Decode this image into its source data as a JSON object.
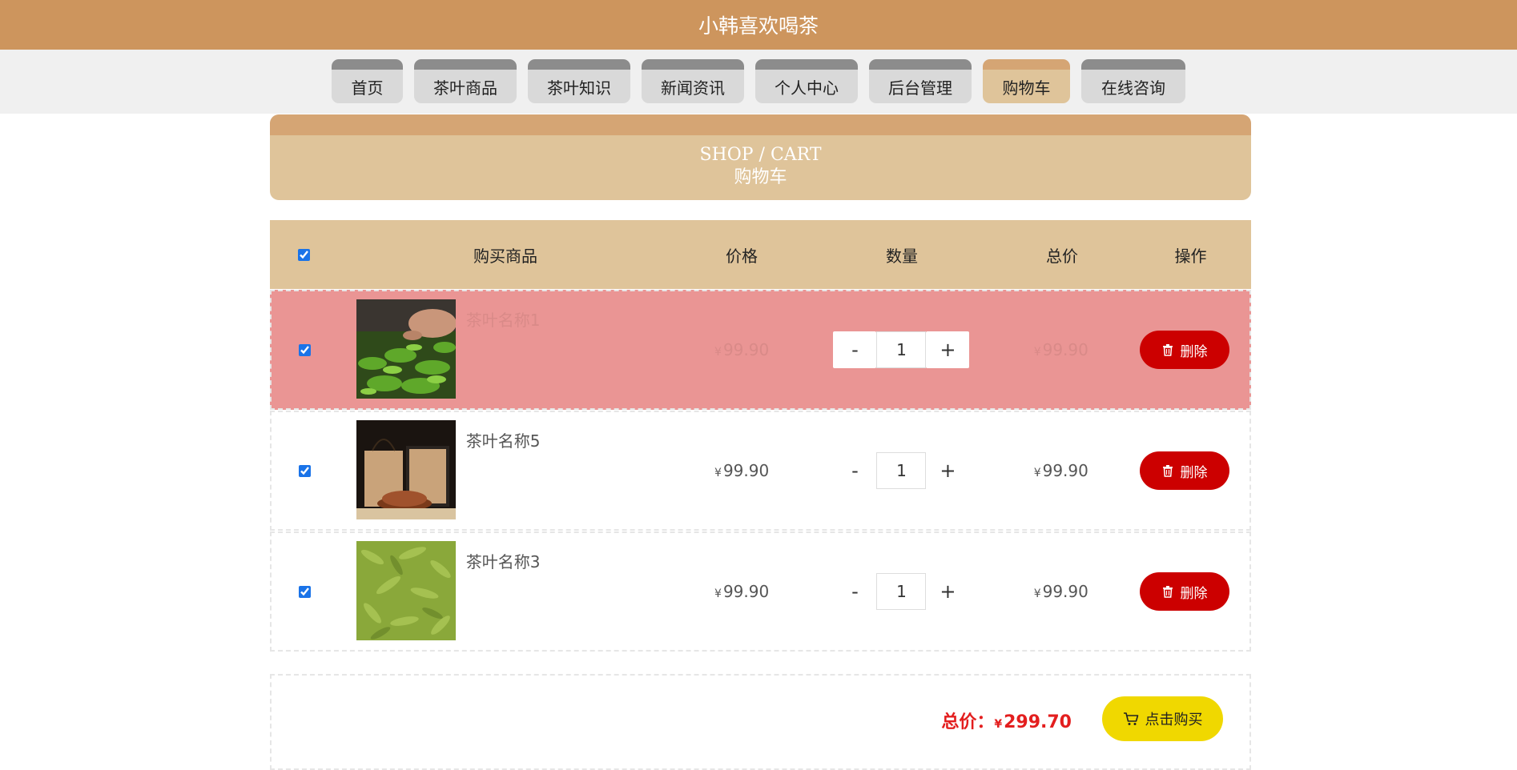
{
  "header": {
    "title": "小韩喜欢喝茶"
  },
  "nav": {
    "items": [
      {
        "label": "首页",
        "width": 89
      },
      {
        "label": "茶叶商品",
        "width": 128
      },
      {
        "label": "茶叶知识",
        "width": 128
      },
      {
        "label": "新闻资讯",
        "width": 128
      },
      {
        "label": "个人中心",
        "width": 128
      },
      {
        "label": "后台管理",
        "width": 128
      },
      {
        "label": "购物车",
        "width": 109,
        "active": true
      },
      {
        "label": "在线咨询",
        "width": 130
      }
    ]
  },
  "banner": {
    "en": "SHOP / CART",
    "zh": "购物车"
  },
  "table": {
    "headers": {
      "product": "购买商品",
      "price": "价格",
      "qty": "数量",
      "total": "总价",
      "op": "操作"
    },
    "rows": [
      {
        "name": "茶叶名称1",
        "price": "99.90",
        "qty": "1",
        "total": "99.90",
        "highlight": true,
        "image": "tea-picking"
      },
      {
        "name": "茶叶名称5",
        "price": "99.90",
        "qty": "1",
        "total": "99.90",
        "highlight": false,
        "image": "tea-giftbox"
      },
      {
        "name": "茶叶名称3",
        "price": "99.90",
        "qty": "1",
        "total": "99.90",
        "highlight": false,
        "image": "tea-leaves"
      }
    ],
    "currency": "¥",
    "minus": "-",
    "plus": "+",
    "delete_label": "删除"
  },
  "footer": {
    "total_label": "总价：",
    "currency": "¥",
    "total_value": "299.70",
    "buy_label": "点击购买"
  },
  "colors": {
    "header": "#cd955d",
    "accent_tan": "#dfc49a",
    "highlight_row": "#ea9594",
    "delete_red": "#cc0000",
    "buy_yellow": "#f0d800",
    "total_red": "#e31e1e"
  }
}
